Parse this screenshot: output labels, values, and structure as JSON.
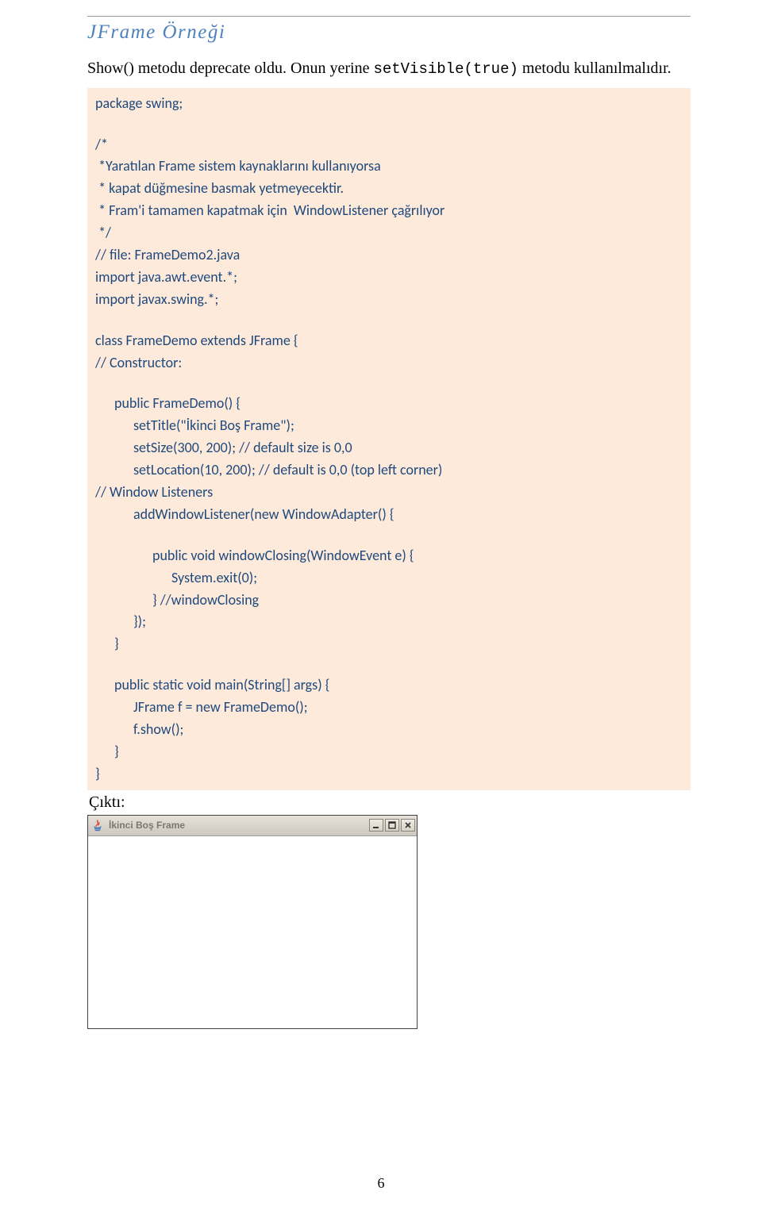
{
  "heading": "JFrame Örneği",
  "intro": {
    "prefix": "Show() metodu deprecate oldu. Onun yerine ",
    "mono": "setVisible(true)",
    "suffix": " metodu kullanılmalıdır."
  },
  "code": {
    "l01": "package swing;",
    "l02": "/*",
    "l03": " *Yaratılan Frame sistem kaynaklarını kullanıyorsa",
    "l04": " * kapat düğmesine basmak yetmeyecektir.",
    "l05": " * Fram'i tamamen kapatmak için  WindowListener çağrılıyor",
    "l06": " */",
    "l07": "// file: FrameDemo2.java",
    "l08": "import java.awt.event.*;",
    "l09": "import javax.swing.*;",
    "l10": "class FrameDemo extends JFrame {",
    "l11": "// Constructor:",
    "l12": "public FrameDemo() {",
    "l13": "setTitle(\"İkinci Boş Frame\");",
    "l14": "setSize(300, 200); // default size is 0,0",
    "l15": "setLocation(10, 200); // default is 0,0 (top left corner)",
    "l16": "// Window Listeners",
    "l17": "addWindowListener(new WindowAdapter() {",
    "l18": "public void windowClosing(WindowEvent e) {",
    "l19": "System.exit(0);",
    "l20": "} //windowClosing",
    "l21": "});",
    "l22": "}",
    "l23": "public static void main(String[] args) {",
    "l24": "JFrame f = new FrameDemo();",
    "l25": "f.show();",
    "l26": "}",
    "l27": "}"
  },
  "output_label": "Çıktı:",
  "window": {
    "title": "İkinci Boş Frame"
  },
  "page_number": "6"
}
